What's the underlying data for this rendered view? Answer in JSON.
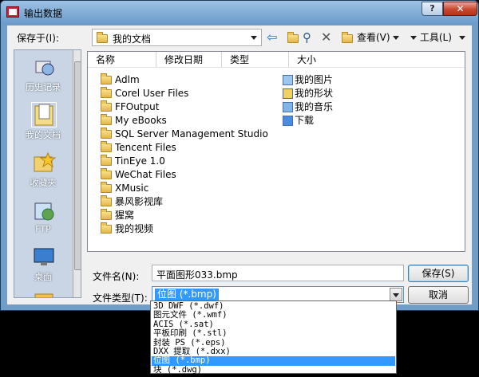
{
  "window": {
    "title": "输出数据",
    "help": "?",
    "close": "✕"
  },
  "toolbar": {
    "save_in_label": "保存于(I):",
    "save_in_value": "我的文档",
    "back": "⇦",
    "search": "⚲",
    "delete": "✕",
    "view_label": "查看(V)",
    "tools_label": "工具(L)"
  },
  "places": [
    {
      "label": "历史记录",
      "icon": "history-icon"
    },
    {
      "label": "我的文档",
      "icon": "my-documents-icon"
    },
    {
      "label": "收藏夹",
      "icon": "favorites-icon"
    },
    {
      "label": "FTP",
      "icon": "ftp-icon"
    },
    {
      "label": "桌面",
      "icon": "desktop-icon"
    }
  ],
  "columns": {
    "name": "名称",
    "modified": "修改日期",
    "type": "类型",
    "size": "大小"
  },
  "folders": [
    "Adlm",
    "Corel User Files",
    "FFOutput",
    "My eBooks",
    "SQL Server Management Studio",
    "Tencent Files",
    "TinEye 1.0",
    "WeChat Files",
    "XMusic",
    "暴风影视库",
    "猩窝",
    "我的视频"
  ],
  "special_folders": [
    "我的图片",
    "我的形状",
    "我的音乐",
    "下载"
  ],
  "form": {
    "filename_label": "文件名(N):",
    "filename_value": "平面图形033.bmp",
    "filetype_label": "文件类型(T):",
    "filetype_value": "位图 (*.bmp)",
    "save_button": "保存(S)",
    "cancel_button": "取消"
  },
  "filetype_options": [
    "3D DWF (*.dwf)",
    "图元文件 (*.wmf)",
    "ACIS (*.sat)",
    "平板印刷 (*.stl)",
    "封装 PS (*.eps)",
    "DXX 提取 (*.dxx)",
    "位图 (*.bmp)",
    "块 (*.dwg)"
  ],
  "colors": {
    "title_bar": "#6f9fc9",
    "selection": "#3399ff",
    "places_bg": "#c9d4e4"
  }
}
